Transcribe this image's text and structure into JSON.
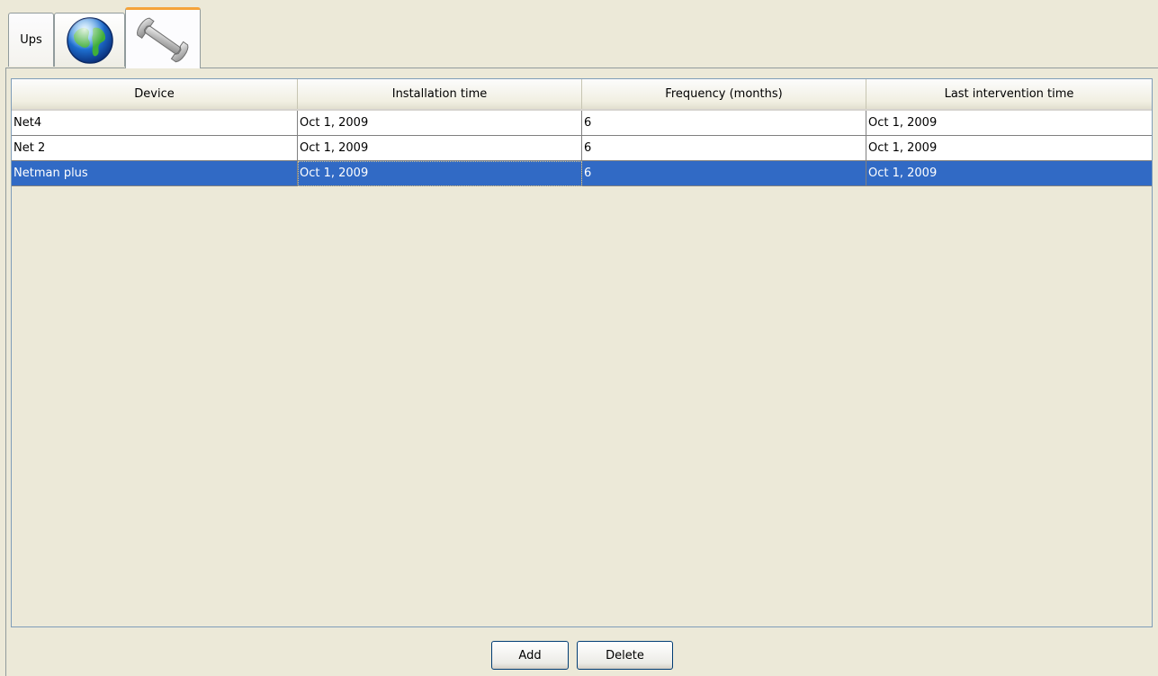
{
  "tabs": [
    {
      "label": "Ups",
      "icon": null
    },
    {
      "label": "",
      "icon": "globe-icon"
    },
    {
      "label": "",
      "icon": "wrench-icon",
      "selected": true
    }
  ],
  "table": {
    "columns": [
      "Device",
      "Installation time",
      "Frequency (months)",
      "Last intervention time"
    ],
    "rows": [
      [
        "Net4",
        "Oct 1, 2009",
        "6",
        "Oct 1, 2009"
      ],
      [
        "Net 2",
        "Oct 1, 2009",
        "6",
        "Oct 1, 2009"
      ],
      [
        "Netman plus",
        "Oct 1, 2009",
        "6",
        "Oct 1, 2009"
      ]
    ],
    "selected_row": 2
  },
  "buttons": {
    "add_label": "Add",
    "delete_label": "Delete"
  },
  "colors": {
    "background": "#ECE9D8",
    "selection": "#316AC5",
    "tab_accent": "#F5A33A"
  }
}
